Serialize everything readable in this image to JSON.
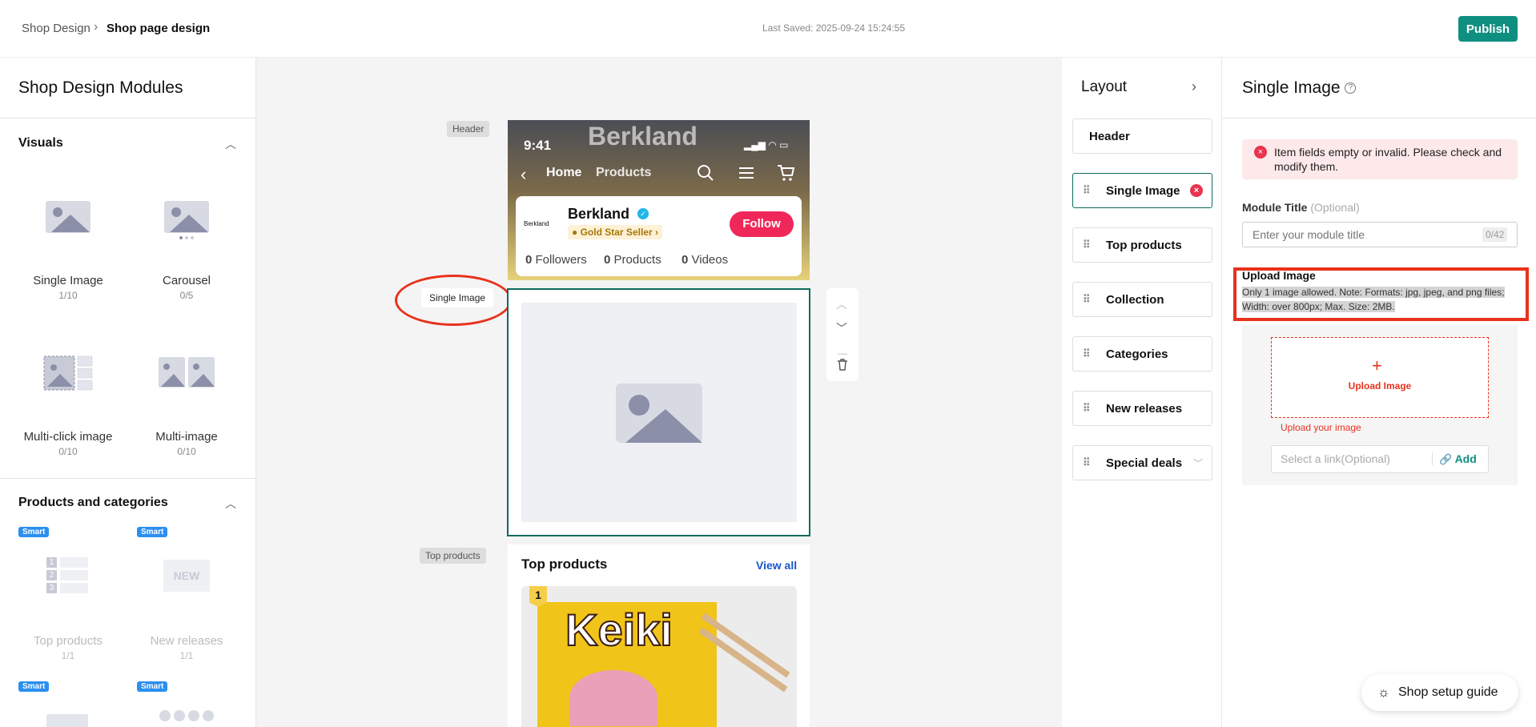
{
  "header": {
    "breadcrumb_root": "Shop Design",
    "breadcrumb_current": "Shop page design",
    "last_saved": "Last Saved: 2025-09-24 15:24:55",
    "publish_label": "Publish"
  },
  "left_panel": {
    "title": "Shop Design Modules",
    "visuals": {
      "title": "Visuals",
      "items": [
        {
          "label": "Single Image",
          "count": "1/10"
        },
        {
          "label": "Carousel",
          "count": "0/5"
        },
        {
          "label": "Multi-click image",
          "count": "0/10"
        },
        {
          "label": "Multi-image",
          "count": "0/10"
        }
      ]
    },
    "products": {
      "title": "Products and categories",
      "smart_label": "Smart",
      "new_badge": "NEW",
      "items": [
        {
          "label": "Top products",
          "count": "1/1"
        },
        {
          "label": "New releases",
          "count": "1/1"
        }
      ],
      "rank_numbers": [
        "1",
        "2",
        "3"
      ]
    }
  },
  "canvas": {
    "tag_header": "Header",
    "tag_single": "Single Image",
    "tag_top": "Top products",
    "phone": {
      "time": "9:41",
      "brand_banner": "Berkland",
      "nav_home": "Home",
      "nav_products": "Products",
      "shop_name": "Berkland",
      "shop_logo": "Berkland",
      "seller_badge": "Gold Star Seller",
      "follow_label": "Follow",
      "followers_n": "0",
      "followers_label": "Followers",
      "products_n": "0",
      "products_label": "Products",
      "videos_n": "0",
      "videos_label": "Videos"
    },
    "top_products": {
      "title": "Top products",
      "view_all": "View all",
      "rank": "1",
      "product_art_text": "Keiki"
    }
  },
  "layout_panel": {
    "title": "Layout",
    "items": [
      "Header",
      "Single Image",
      "Top products",
      "Collection",
      "Categories",
      "New releases",
      "Special deals"
    ]
  },
  "right_panel": {
    "title": "Single Image",
    "error": "Item fields empty or invalid. Please check and modify them.",
    "module_title_label": "Module Title",
    "module_title_optional": "(Optional)",
    "module_title_placeholder": "Enter your module title",
    "module_title_count": "0/42",
    "upload_label": "Upload Image",
    "upload_note": "Only 1 image allowed. Note: Formats: jpg, jpeg, and png files; Width: over 800px; Max. Size: 2MB.",
    "upload_button": "Upload Image",
    "upload_error": "Upload your image",
    "link_placeholder": "Select a link(Optional)",
    "add_label": "Add"
  },
  "guide_label": "Shop setup guide",
  "colors": {
    "accent": "#0f8f80",
    "error": "#e8321c",
    "follow": "#f0285a",
    "smart": "#2b8ff0"
  }
}
